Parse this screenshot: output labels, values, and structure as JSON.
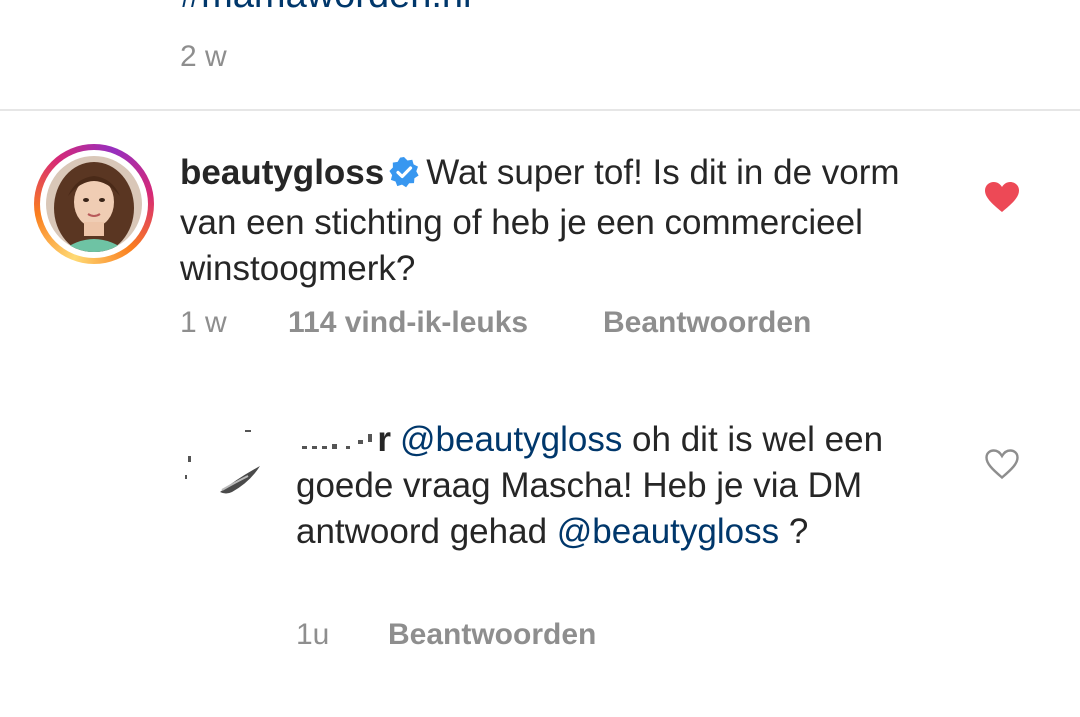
{
  "previous_comment": {
    "hashtag": "#mamaworden.nl",
    "time": "2 w"
  },
  "comment": {
    "username": "beautygloss",
    "verified": true,
    "text": "Wat super tof! Is dit in de vorm van een stichting of heb je een commercieel winstoogmerk?",
    "time": "1 w",
    "likes": "114 vind-ik-leuks",
    "reply_label": "Beantwoorden",
    "liked": true,
    "heart_color": "#ed4956"
  },
  "reply": {
    "username_fragment": "...r",
    "mention_1": "@beautygloss",
    "text_1": " oh dit is wel een goede vraag Mascha! Heb je via DM antwoord gehad ",
    "mention_2": "@beautygloss",
    "text_2": " ?",
    "time": "1u",
    "reply_label": "Beantwoorden",
    "liked": false
  },
  "colors": {
    "text": "#262626",
    "secondary": "#8e8e8e",
    "mention": "#00376b",
    "verified_badge": "#3897f0"
  }
}
